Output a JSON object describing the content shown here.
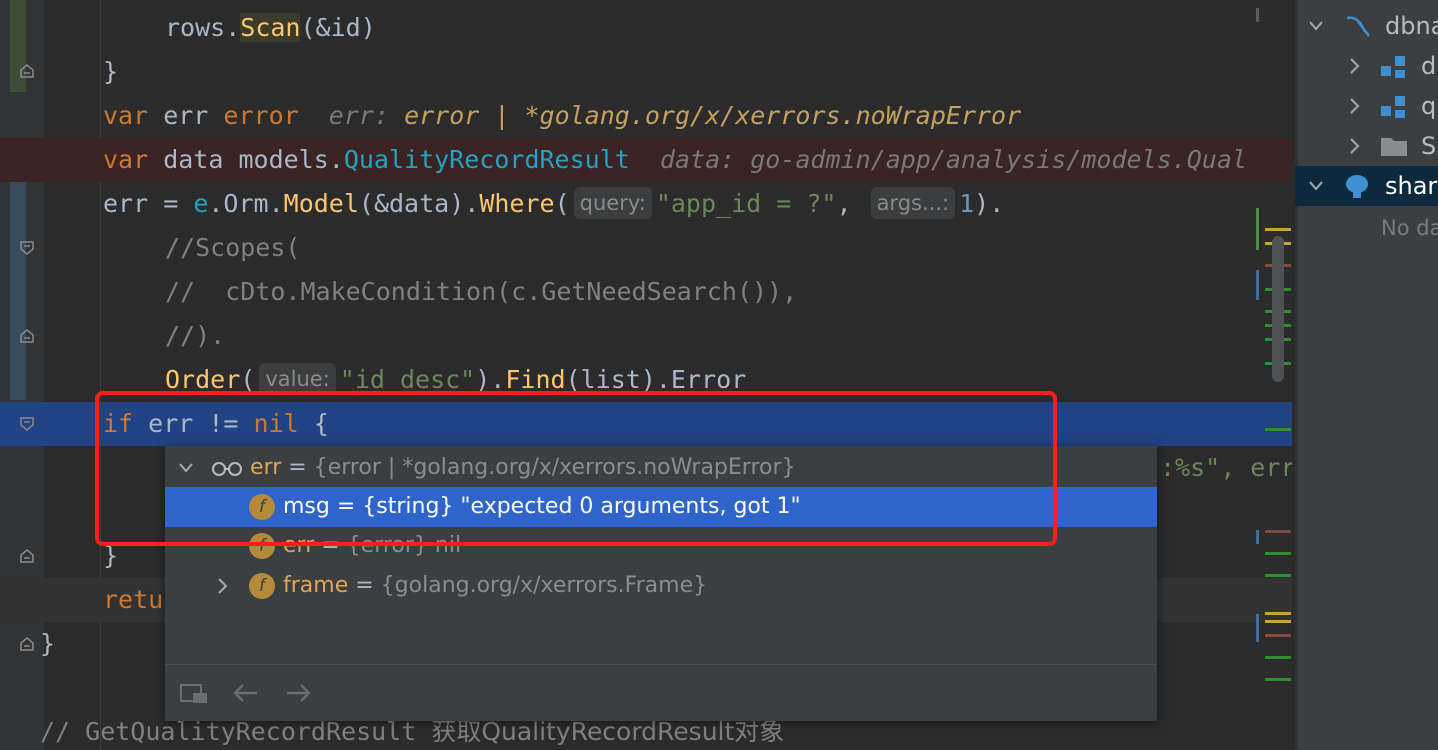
{
  "code": {
    "line1": {
      "a": "rows.",
      "b": "Scan",
      "c": "(&id)"
    },
    "line2": "}",
    "line3": {
      "kw": "var",
      "name": " err ",
      "type": "error",
      "hint_name": "err: ",
      "hint_type": "error | *golang.org/x/xerrors.noWrapError"
    },
    "line4": {
      "kw": "var",
      "name": " data ",
      "pkg": "models.",
      "type": "QualityRecordResult",
      "hint": "data: go-admin/app/analysis/models.Qual"
    },
    "line5": {
      "a": "err = ",
      "b": "e",
      "c": ".Orm.",
      "d": "Model",
      "e": "(&data).",
      "f": "Where",
      "g": "(",
      "hint1": "query:",
      "str": "\"app_id = ?\"",
      "comma": ", ",
      "hint2": "args...:",
      "num": "1",
      "end": ")."
    },
    "line6": "//Scopes(",
    "line7": "//  cDto.MakeCondition(c.GetNeedSearch()),",
    "line8": "//).",
    "line9": {
      "a": "Order",
      "b": "(",
      "hint": "value:",
      "str": "\"id desc\"",
      "c": ").",
      "d": "Find",
      "e": "(list).Error"
    },
    "line10": {
      "kw1": "if",
      "a": " err != ",
      "kw2": "nil",
      "b": " {"
    },
    "line11_tail": ":%s\", err",
    "line13": "}",
    "line14": "retu",
    "line15": "}",
    "line17": {
      "cmt": "// GetQualityRecordResult ",
      "cmt_cn": "获取QualityRecordResult对象"
    }
  },
  "popup": {
    "root": {
      "name": "err",
      "eq": " = ",
      "val": "{error | *golang.org/x/xerrors.noWrapError}"
    },
    "rows": [
      {
        "badge": "f",
        "name": "msg",
        "eq": " = ",
        "val": "{string} \"expected 0 arguments, got 1\""
      },
      {
        "badge": "f",
        "name": "err",
        "eq": " = ",
        "val": "{error} nil"
      },
      {
        "badge": "f",
        "name": "frame",
        "eq": " = ",
        "val": "{golang.org/x/xerrors.Frame}"
      }
    ]
  },
  "db_panel": {
    "items": [
      {
        "label": "dbna"
      },
      {
        "label": "d"
      },
      {
        "label": "q"
      },
      {
        "label": "S"
      },
      {
        "label": "shar"
      },
      {
        "label": "No da"
      }
    ]
  },
  "colors": {
    "accent": "#2f65ca",
    "highlight_box": "#ff1c1c",
    "current_line": "#214283"
  }
}
